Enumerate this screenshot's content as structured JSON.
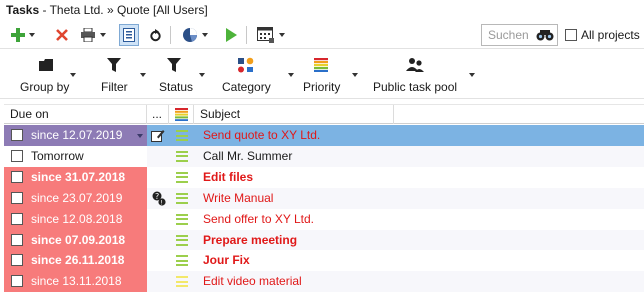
{
  "titlebar": {
    "section": "Tasks",
    "path": " - Theta Ltd. » Quote [All Users]"
  },
  "toolbar": {
    "search_placeholder": "Suchen",
    "all_projects_label": "All projects",
    "all_projects_checked": false
  },
  "ribbon": [
    {
      "label": "Group by",
      "icon": "folder-icon"
    },
    {
      "label": "Filter",
      "icon": "funnel-icon"
    },
    {
      "label": "Status",
      "icon": "funnel-icon"
    },
    {
      "label": "Category",
      "icon": "category-icon"
    },
    {
      "label": "Priority",
      "icon": "priority-icon"
    },
    {
      "label": "Public task pool",
      "icon": "users-icon"
    }
  ],
  "columns": {
    "due": "Due on",
    "extra": "...",
    "subject": "Subject"
  },
  "colors": {
    "overdue": "#f77b7b",
    "selected_due": "#8d7bb5",
    "selected_row": "#7cb3e3",
    "subject_red": "#e01818",
    "prio_green": "#9ccf4c",
    "prio_yellow": "#f3e86a"
  },
  "rows": [
    {
      "due": "since 12.07.2019",
      "subject": "Send quote to XY Ltd.",
      "bold": false,
      "state": "selected",
      "extra": "edit-note-icon",
      "priority": "green"
    },
    {
      "due": "Tomorrow",
      "subject": "Call Mr. Summer",
      "bold": false,
      "state": "normal",
      "extra": "",
      "priority": "green"
    },
    {
      "due": "since 31.07.2018",
      "subject": "Edit files",
      "bold": true,
      "state": "overdue",
      "extra": "",
      "priority": "green"
    },
    {
      "due": "since 23.07.2019",
      "subject": "Write Manual",
      "bold": false,
      "state": "overdue",
      "extra": "question-people-icon",
      "priority": "green"
    },
    {
      "due": "since 12.08.2018",
      "subject": "Send offer to XY Ltd.",
      "bold": false,
      "state": "overdue",
      "extra": "",
      "priority": "green"
    },
    {
      "due": "since 07.09.2018",
      "subject": "Prepare meeting",
      "bold": true,
      "state": "overdue",
      "extra": "",
      "priority": "green"
    },
    {
      "due": "since 26.11.2018",
      "subject": "Jour Fix",
      "bold": true,
      "state": "overdue",
      "extra": "",
      "priority": "green"
    },
    {
      "due": "since 13.11.2018",
      "subject": "Edit video material",
      "bold": false,
      "state": "overdue",
      "extra": "",
      "priority": "yellow"
    }
  ]
}
